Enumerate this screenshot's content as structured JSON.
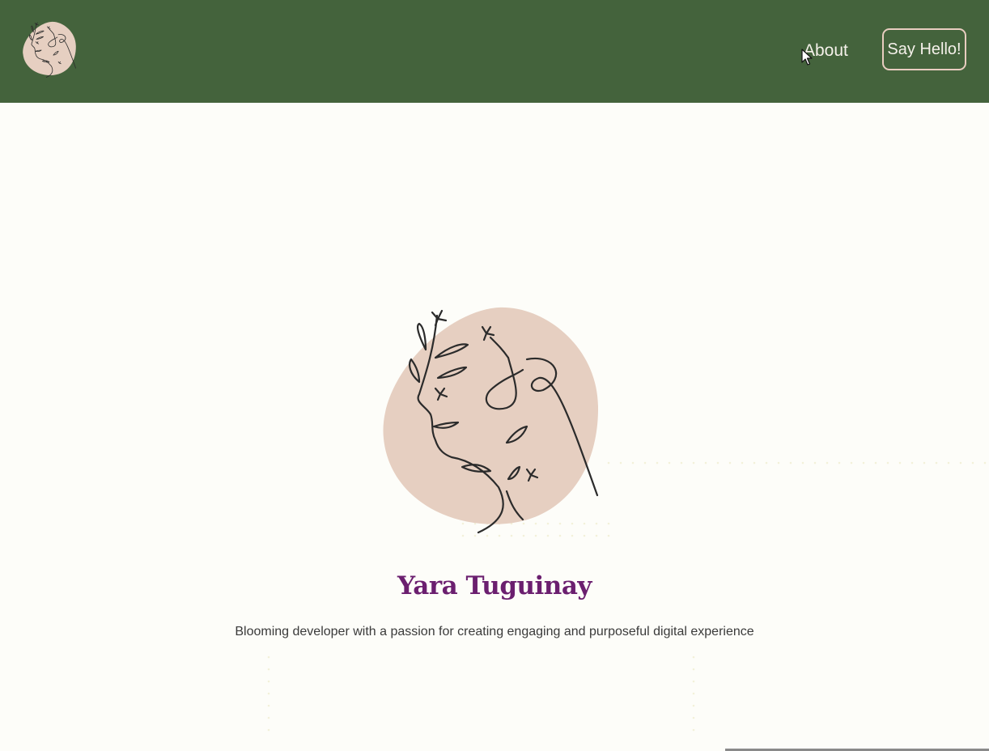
{
  "header": {
    "logo_icon": "woman-face-floral-line-art-icon",
    "nav": {
      "about_label": "About",
      "say_hello_label": "Say Hello!"
    }
  },
  "hero": {
    "illustration_icon": "woman-face-floral-line-art-icon",
    "name": "Yara Tuguinay",
    "tagline": "Blooming developer with a passion for creating engaging and purposeful digital experience"
  },
  "colors": {
    "navbar": "#44633c",
    "page_background": "#fdfdf9",
    "blob": "#e6cfc1",
    "name": "#6b1f6f",
    "nav_text": "#f5f1ea",
    "button_border": "#e8cdc0"
  }
}
